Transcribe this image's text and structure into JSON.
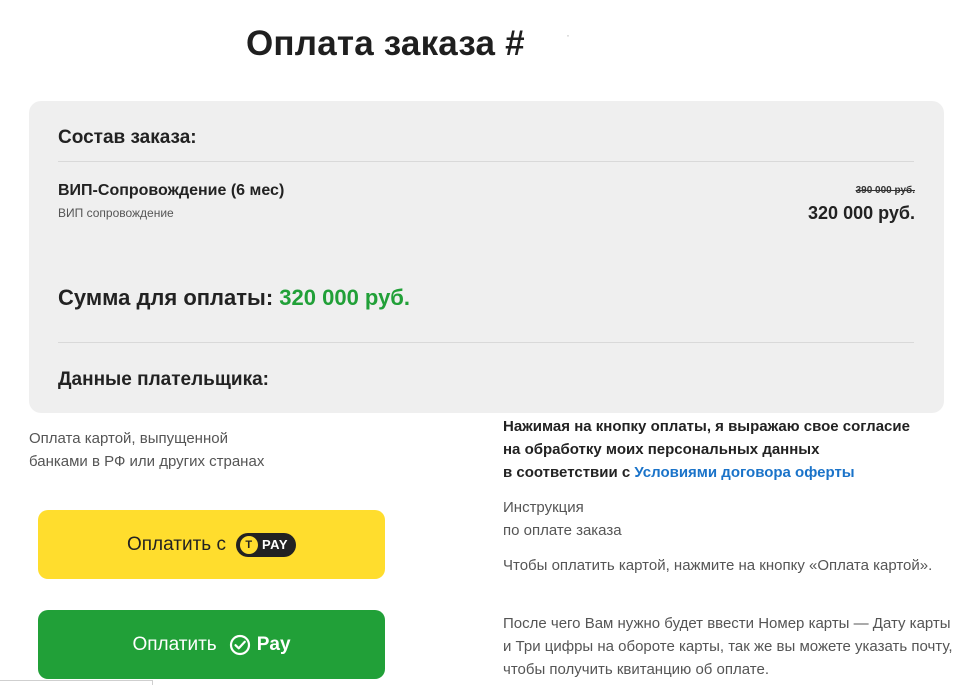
{
  "page": {
    "title": "Оплата заказа #",
    "title_extra": "·"
  },
  "order": {
    "heading": "Состав заказа:",
    "item_name": "ВИП-Сопровождение (6 мес)",
    "item_sub": "ВИП сопровождение",
    "old_price": "390 000 руб.",
    "price": "320 000 руб.",
    "total_label": "Сумма для оплаты:",
    "total_value": "320 000 руб.",
    "payer_heading": "Данные плательщика:"
  },
  "payment": {
    "card_note_line1": "Оплата картой, выпущенной",
    "card_note_line2": "банками в РФ или других странах",
    "tpay_label": "Оплатить с",
    "tpay_badge_text": "PAY",
    "tpay_badge_letter": "T",
    "sberpay_label": "Оплатить",
    "sberpay_brand": "Pay"
  },
  "consent": {
    "line1": "Нажимая на кнопку оплаты, я выражаю свое согласие",
    "line2": "на обработку моих персональных данных",
    "line3_prefix": "в соответствии с",
    "link": "Условиями договора оферты"
  },
  "instructions": {
    "title_line1": "Инструкция",
    "title_line2": "по оплате заказа",
    "p1": "Чтобы оплатить картой, нажмите на кнопку «Оплата картой».",
    "p2": "После чего Вам нужно будет ввести Номер карты — Дату карты и Три цифры на обороте карты, так же вы можете указать почту, чтобы получить квитанцию об оплате."
  },
  "colors": {
    "accent_green": "#21a038",
    "tpay_yellow": "#ffdd2d",
    "link_blue": "#1a73c9",
    "card_bg": "#efefef"
  },
  "icons": [
    "tpay-logo-icon",
    "sberpay-check-icon"
  ]
}
